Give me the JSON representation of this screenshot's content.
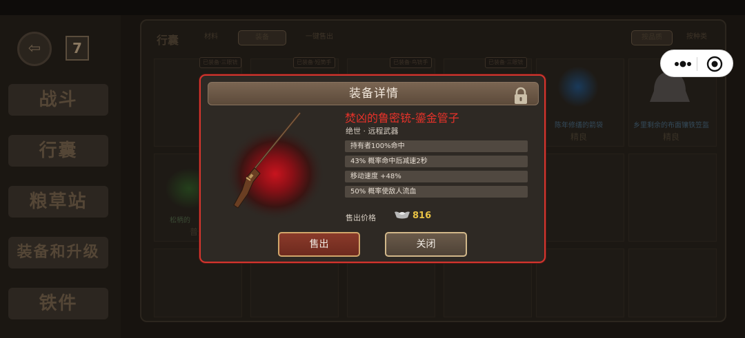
{
  "background": {
    "panel_title": "行囊",
    "tabs": [
      "材料",
      "装备",
      "一键售出"
    ],
    "sort_options": [
      "按品质",
      "按种类"
    ],
    "nav_buttons": [
      "战斗",
      "行囊",
      "粮草站",
      "装备和升级",
      "铁件"
    ],
    "calendar_day": "7",
    "slot_tags": [
      "已装备·三眼铳",
      "已装备·短筒手",
      "已装备·鸟铳手",
      "已装备·三眼铳"
    ],
    "slot_items": [
      {
        "label": "陈年修缮的箭袋",
        "grade": "精良"
      },
      {
        "label": "乡里剩余的布面镶铁笠盔",
        "grade": "精良"
      },
      {
        "label": "松柄的",
        "grade": "普通"
      }
    ]
  },
  "capsule": {
    "more_icon": "more-dots-icon",
    "close_icon": "target-close-icon"
  },
  "modal": {
    "title": "装备详情",
    "item_name": "焚凶的鲁密铳-鎏金管子",
    "item_type": "绝世 · 远程武器",
    "attributes": [
      "持有者100%命中",
      "43% 概率命中后减速2秒",
      "移动速度 +48%",
      "50% 概率使敌人流血"
    ],
    "price_label": "售出价格",
    "price_value": "816",
    "sell_label": "售出",
    "close_label": "关闭",
    "colors": {
      "border": "#d5352e",
      "item_name": "#e8322a",
      "price": "#e8c244"
    }
  }
}
